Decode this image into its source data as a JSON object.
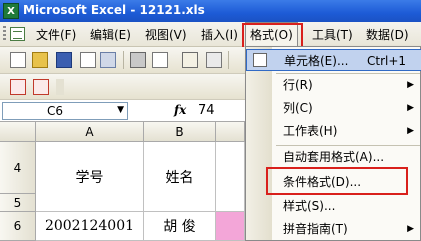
{
  "window": {
    "title": "Microsoft Excel - 12121.xls",
    "app_icon_letter": "X"
  },
  "menubar": {
    "items": [
      {
        "label": "文件(F)"
      },
      {
        "label": "编辑(E)"
      },
      {
        "label": "视图(V)"
      },
      {
        "label": "插入(I)"
      },
      {
        "label": "格式(O)"
      },
      {
        "label": "工具(T)"
      },
      {
        "label": "数据(D)"
      }
    ],
    "active_menu": "格式(O)"
  },
  "formula_bar": {
    "name_box": "C6",
    "fx_label": "fx",
    "value": "74"
  },
  "grid": {
    "columns": [
      "A",
      "B"
    ],
    "rows": [
      "4",
      "5",
      "6"
    ],
    "cells": {
      "A4": "学号",
      "B4": "姓名",
      "A6": "2002124001",
      "B6": "胡  俊"
    },
    "highlight_color": "#f3a6d8"
  },
  "format_menu": {
    "items": [
      {
        "label": "单元格(E)...",
        "shortcut": "Ctrl+1",
        "submenu": false
      },
      {
        "label": "行(R)",
        "shortcut": "",
        "submenu": true
      },
      {
        "label": "列(C)",
        "shortcut": "",
        "submenu": true
      },
      {
        "label": "工作表(H)",
        "shortcut": "",
        "submenu": true
      },
      {
        "label": "自动套用格式(A)...",
        "shortcut": "",
        "submenu": false
      },
      {
        "label": "条件格式(D)...",
        "shortcut": "",
        "submenu": false
      },
      {
        "label": "样式(S)...",
        "shortcut": "",
        "submenu": false
      },
      {
        "label": "拼音指南(T)",
        "shortcut": "",
        "submenu": true
      }
    ],
    "hovered_item": "单元格(E)..."
  },
  "colors": {
    "annotation_red": "#d9201c",
    "titlebar_blue": "#1d5bd6",
    "menu_hover": "#c1d2ee"
  }
}
